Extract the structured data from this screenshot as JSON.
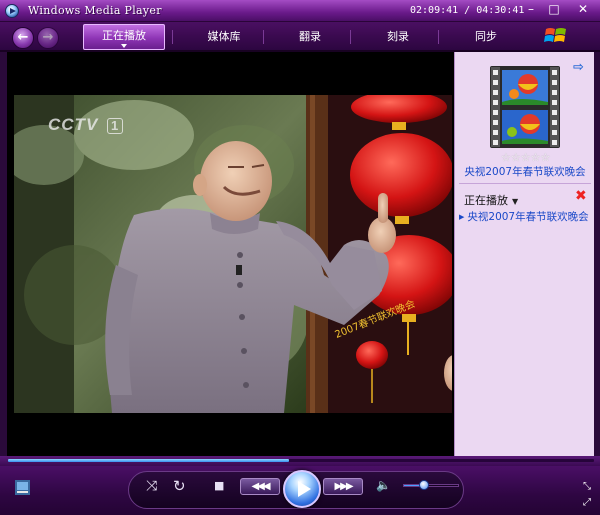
{
  "window": {
    "title": "Windows Media Player",
    "time": "02:09:41 / 04:30:41",
    "min_glyph": "–",
    "max_glyph": "□",
    "close_glyph": "✕"
  },
  "nav": {
    "back_glyph": "←",
    "fwd_glyph": "→",
    "tabs": [
      {
        "label": "正在播放",
        "active": true
      },
      {
        "label": "媒体库",
        "active": false
      },
      {
        "label": "翻录",
        "active": false
      },
      {
        "label": "刻录",
        "active": false
      },
      {
        "label": "同步",
        "active": false
      }
    ]
  },
  "video": {
    "channel_logo": "CCTV",
    "channel_number": "1",
    "caption": "2007春节联欢晚会"
  },
  "side_pane": {
    "arrow_glyph": "⇨",
    "rating_stars": "☆☆☆☆☆",
    "media_title": "央视2007年春节联欢晚会",
    "now_playing_header": "正在播放",
    "dropdown_glyph": "▼",
    "clear_glyph": "✖",
    "playlist": [
      {
        "bullet": "▶",
        "label": "央视2007年春节联欢晚会"
      }
    ]
  },
  "playback": {
    "seek_progress": 0.48,
    "volume": 0.38
  },
  "controls": {
    "shuffle_glyph": "⤨",
    "repeat_glyph": "↻",
    "stop_glyph": "■",
    "prev_glyph": "◀◀◀",
    "next_glyph": "▶▶▶",
    "mute_glyph": "🔈",
    "resize_glyph": "⤡",
    "fullscreen_glyph": "⤢"
  },
  "colors": {
    "frame_purple": "#5a1a78",
    "pane_background": "#ebd8f2",
    "link_blue": "#1a48c8",
    "accent_blue": "#3a8ef0"
  }
}
